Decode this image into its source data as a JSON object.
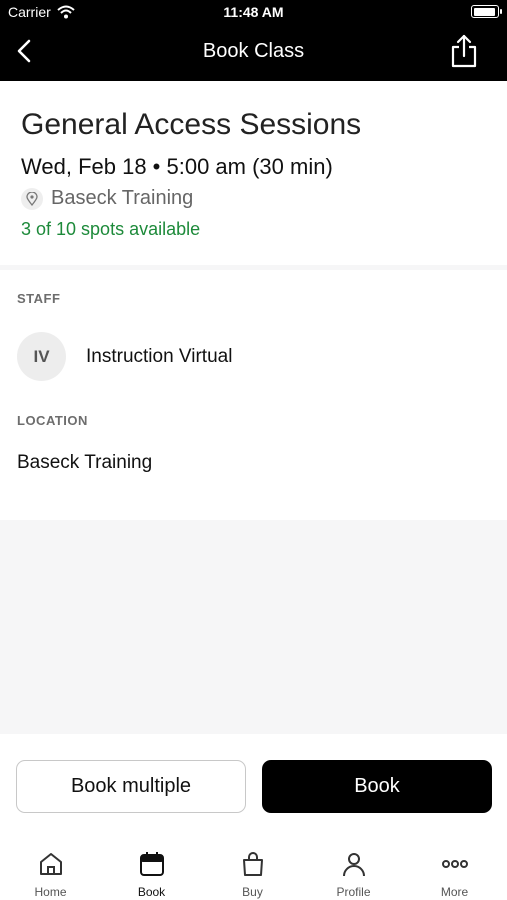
{
  "status_bar": {
    "carrier": "Carrier",
    "time": "11:48 AM"
  },
  "nav": {
    "title": "Book Class",
    "back_icon": "chevron-left-icon",
    "share_icon": "share-icon"
  },
  "class": {
    "title": "General Access Sessions",
    "datetime": "Wed, Feb 18 • 5:00 am (30 min)",
    "location": "Baseck Training",
    "spots": "3 of 10 spots available",
    "spots_color": "#1d8a3a"
  },
  "staff": {
    "label": "STAFF",
    "initials": "IV",
    "name": "Instruction Virtual"
  },
  "location": {
    "label": "LOCATION",
    "name": "Baseck Training"
  },
  "actions": {
    "book_multiple": "Book multiple",
    "book": "Book"
  },
  "tabs": [
    {
      "label": "Home",
      "icon": "home-icon"
    },
    {
      "label": "Book",
      "icon": "calendar-icon",
      "active": true
    },
    {
      "label": "Buy",
      "icon": "shopping-bag-icon"
    },
    {
      "label": "Profile",
      "icon": "profile-icon"
    },
    {
      "label": "More",
      "icon": "more-icon"
    }
  ]
}
